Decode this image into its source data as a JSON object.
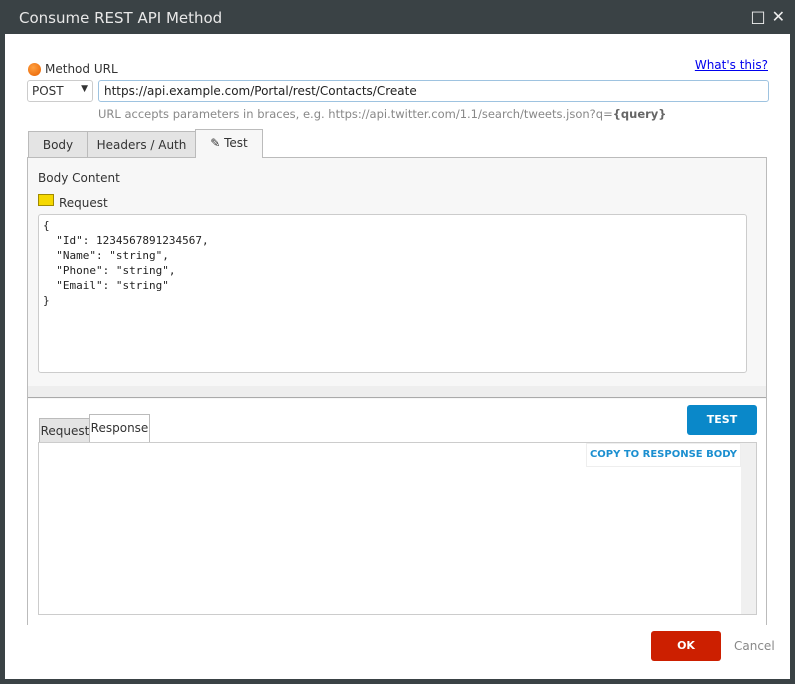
{
  "window": {
    "title": "Consume REST API Method",
    "maximize_icon": "□",
    "close_icon": "✕"
  },
  "method_url": {
    "label": "Method URL",
    "whats_this": "What's this?",
    "method": "POST",
    "url": "https://api.example.com/Portal/rest/Contacts/Create",
    "hint_prefix": "URL accepts parameters in braces, e.g. https://api.twitter.com/1.1/search/tweets.json?q=",
    "hint_param": "{query}"
  },
  "tabs": [
    {
      "label": "Body"
    },
    {
      "label": "Headers / Auth"
    },
    {
      "label": "Test",
      "active": true
    }
  ],
  "test": {
    "section_label": "Body Content",
    "request_label": "Request",
    "request_body": "{\n  \"Id\": 1234567891234567,\n  \"Name\": \"string\",\n  \"Phone\": \"string\",\n  \"Email\": \"string\"\n}",
    "test_button": "TEST",
    "result_tabs": [
      {
        "label": "Request"
      },
      {
        "label": "Response",
        "active": true
      }
    ],
    "copy_button": "COPY TO RESPONSE BODY",
    "response_body": ""
  },
  "footer": {
    "ok": "OK",
    "cancel": "Cancel"
  }
}
